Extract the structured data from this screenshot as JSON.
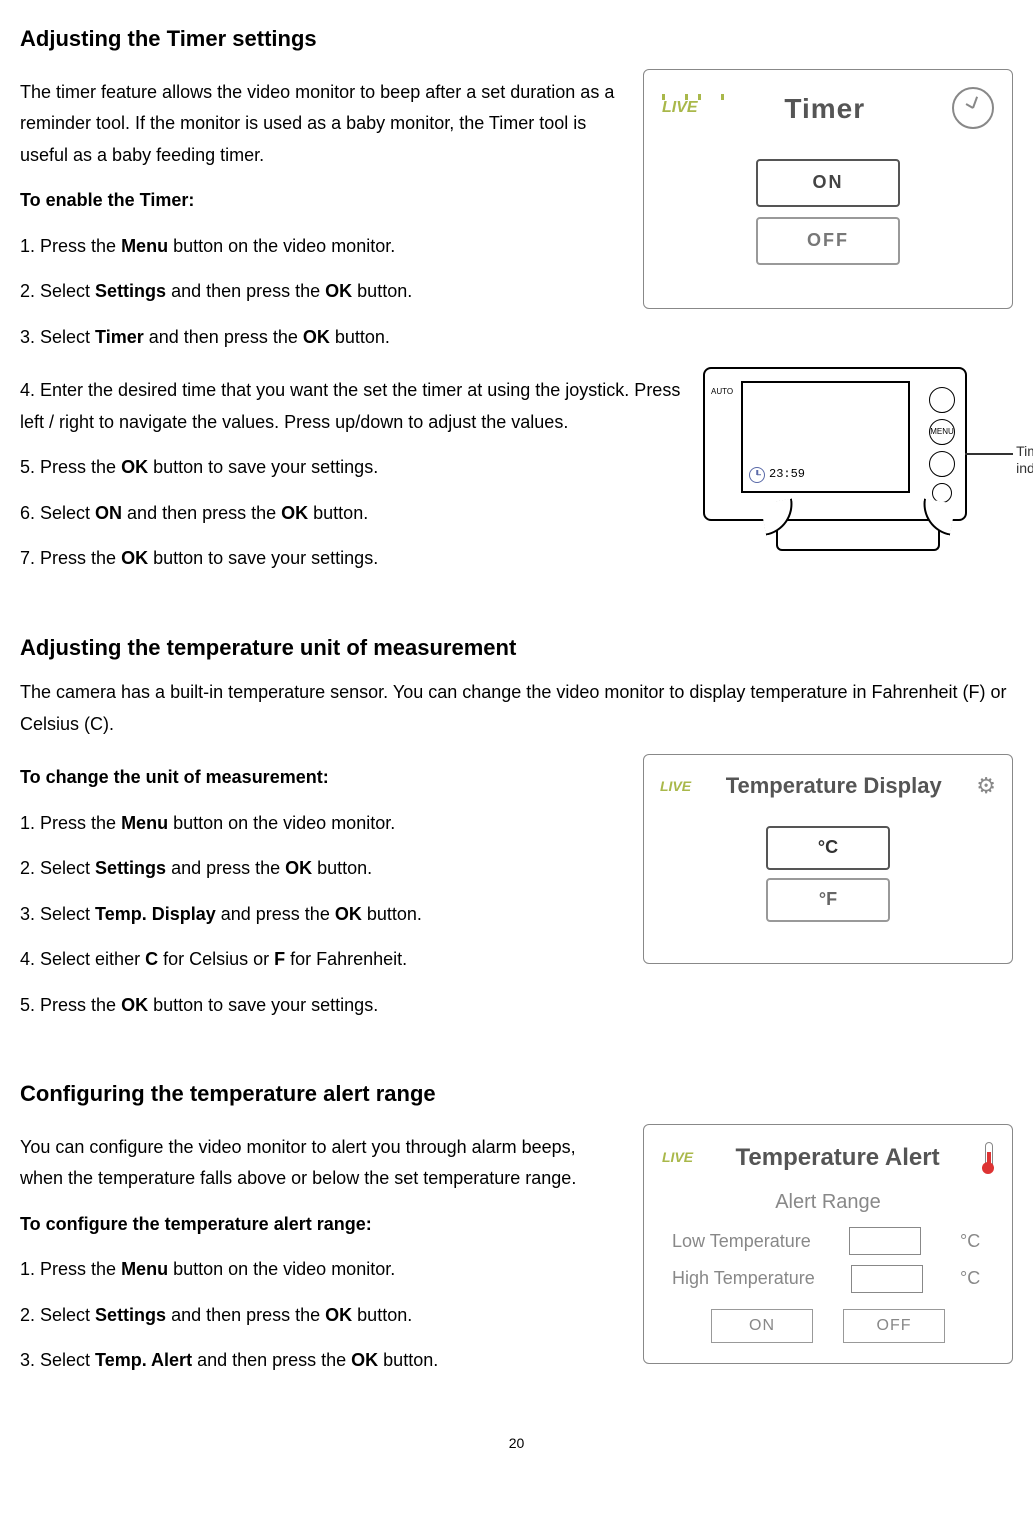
{
  "page_number": "20",
  "section1": {
    "heading": "Adjusting the Timer settings",
    "intro": "The timer feature allows the video monitor to beep after a set duration as a reminder tool. If the monitor is used as a baby monitor, the Timer tool is useful as a baby feeding timer.",
    "subhead": "To enable the Timer:",
    "steps": {
      "s1a": "1. Press the ",
      "s1b": "Menu",
      "s1c": " button on the video monitor.",
      "s2a": "2. Select ",
      "s2b": "Settings",
      "s2c": " and then press the ",
      "s2d": "OK",
      "s2e": " button.",
      "s3a": "3. Select ",
      "s3b": "Timer",
      "s3c": " and then press the ",
      "s3d": "OK",
      "s3e": " button.",
      "s4": "4. Enter the desired time that you want the set the timer at using the joystick. Press left / right to navigate the values. Press up/down to adjust the values.",
      "s5a": "5. Press the ",
      "s5b": "OK",
      "s5c": " button to save your settings.",
      "s6a": "6. Select ",
      "s6b": "ON",
      "s6c": " and then press the ",
      "s6d": "OK",
      "s6e": " button.",
      "s7a": "7. Press the ",
      "s7b": "OK",
      "s7c": " button to save your settings."
    },
    "figure_timer": {
      "live": "LIVE",
      "title": "Timer",
      "on": "ON",
      "off": "OFF"
    },
    "figure_device": {
      "auto": "AUTO",
      "menu": "MENU",
      "time": "23:59",
      "callout": "Timer\nindicator"
    }
  },
  "section2": {
    "heading": "Adjusting the temperature unit of measurement",
    "intro": "The camera has a built-in temperature sensor. You can change the video monitor to display temperature in Fahrenheit (F) or Celsius (C).",
    "subhead": "To change the unit of measurement:",
    "steps": {
      "s1a": "1. Press the ",
      "s1b": "Menu",
      "s1c": " button on the video monitor.",
      "s2a": "2. Select ",
      "s2b": "Settings",
      "s2c": " and press the ",
      "s2d": "OK",
      "s2e": " button.",
      "s3a": "3. Select ",
      "s3b": "Temp. Display",
      "s3c": " and press the ",
      "s3d": "OK",
      "s3e": " button.",
      "s4a": "4. Select either ",
      "s4b": "C",
      "s4c": " for Celsius or ",
      "s4d": "F",
      "s4e": " for Fahrenheit.",
      "s5a": "5. Press the ",
      "s5b": "OK",
      "s5c": " button to save your settings."
    },
    "figure": {
      "live": "LIVE",
      "title": "Temperature Display",
      "opt_c": "°C",
      "opt_f": "°F"
    }
  },
  "section3": {
    "heading": "Configuring the temperature alert range",
    "intro": "You can configure the video monitor to alert you through alarm beeps, when the temperature falls above or below the set temperature range.",
    "subhead": "To configure the temperature alert range:",
    "steps": {
      "s1a": "1. Press the ",
      "s1b": "Menu",
      "s1c": " button on the video monitor.",
      "s2a": "2. Select ",
      "s2b": "Settings",
      "s2c": " and then press the ",
      "s2d": "OK",
      "s2e": " button.",
      "s3a": "3. Select ",
      "s3b": "Temp. Alert",
      "s3c": " and then press the ",
      "s3d": "OK",
      "s3e": " button."
    },
    "figure": {
      "live": "LIVE",
      "title": "Temperature Alert",
      "range_label": "Alert Range",
      "low": "Low Temperature",
      "high": "High Temperature",
      "unit": "°C",
      "on": "ON",
      "off": "OFF"
    }
  }
}
